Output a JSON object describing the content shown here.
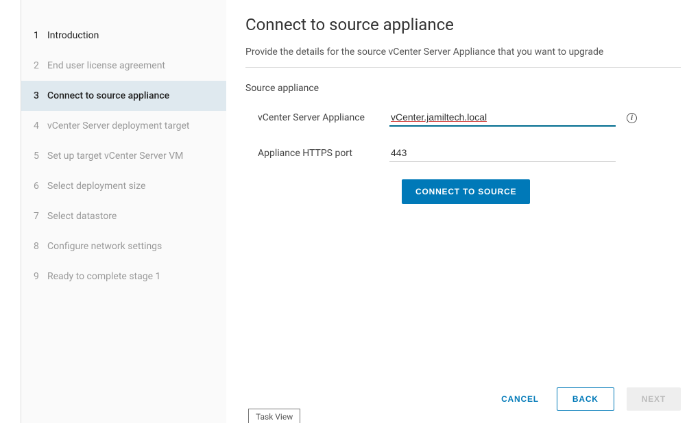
{
  "steps": [
    {
      "num": "1",
      "label": "Introduction"
    },
    {
      "num": "2",
      "label": "End user license agreement"
    },
    {
      "num": "3",
      "label": "Connect to source appliance"
    },
    {
      "num": "4",
      "label": "vCenter Server deployment target"
    },
    {
      "num": "5",
      "label": "Set up target vCenter Server VM"
    },
    {
      "num": "6",
      "label": "Select deployment size"
    },
    {
      "num": "7",
      "label": "Select datastore"
    },
    {
      "num": "8",
      "label": "Configure network settings"
    },
    {
      "num": "9",
      "label": "Ready to complete stage 1"
    }
  ],
  "page": {
    "title": "Connect to source appliance",
    "subtitle": "Provide the details for the source vCenter Server Appliance that you want to upgrade",
    "section_label": "Source appliance"
  },
  "form": {
    "appliance_label": "vCenter Server Appliance",
    "appliance_value": "vCenter.jamiltech.local",
    "port_label": "Appliance HTTPS port",
    "port_value": "443",
    "connect_button": "CONNECT TO SOURCE"
  },
  "footer": {
    "cancel": "CANCEL",
    "back": "BACK",
    "next": "NEXT"
  },
  "task_view": "Task View"
}
